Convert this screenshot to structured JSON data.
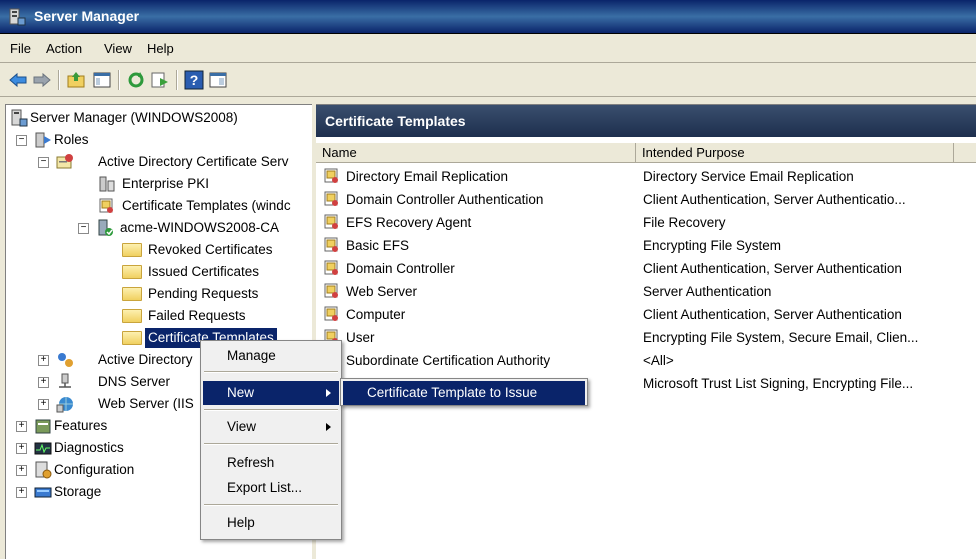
{
  "window": {
    "title": "Server Manager",
    "icon": "server-manager-icon"
  },
  "menubar": {
    "file": "File",
    "action": "Action",
    "view": "View",
    "help": "Help"
  },
  "toolbar": {
    "icons": [
      "back-arrow-icon",
      "forward-arrow-icon",
      "up-folder-icon",
      "show-hide-tree-icon",
      "refresh-icon",
      "export-list-icon",
      "help-icon",
      "properties-icon"
    ]
  },
  "tree": {
    "root": "Server Manager (WINDOWS2008)",
    "roles": "Roles",
    "adcs": "Active Directory Certificate Serv",
    "enterprise_pki": "Enterprise PKI",
    "cert_templates_domain": "Certificate Templates (windc",
    "ca": "acme-WINDOWS2008-CA",
    "revoked": "Revoked Certificates",
    "issued": "Issued Certificates",
    "pending": "Pending Requests",
    "failed": "Failed Requests",
    "ca_templates": "Certificate Templates",
    "ad_other": "Active Directory",
    "dns": "DNS Server",
    "web": "Web Server (IIS",
    "features": "Features",
    "diagnostics": "Diagnostics",
    "configuration": "Configuration",
    "storage": "Storage"
  },
  "main": {
    "header": "Certificate Templates",
    "columns": {
      "name": "Name",
      "purpose": "Intended Purpose"
    },
    "rows": [
      {
        "name": "Directory Email Replication",
        "purpose": "Directory Service Email Replication"
      },
      {
        "name": "Domain Controller Authentication",
        "purpose": "Client Authentication, Server Authenticatio..."
      },
      {
        "name": "EFS Recovery Agent",
        "purpose": "File Recovery"
      },
      {
        "name": "Basic EFS",
        "purpose": "Encrypting File System"
      },
      {
        "name": "Domain Controller",
        "purpose": "Client Authentication, Server Authentication"
      },
      {
        "name": "Web Server",
        "purpose": "Server Authentication"
      },
      {
        "name": "Computer",
        "purpose": "Client Authentication, Server Authentication"
      },
      {
        "name": "User",
        "purpose": "Encrypting File System, Secure Email, Clien..."
      },
      {
        "name": "Subordinate Certification Authority",
        "purpose": "<All>"
      },
      {
        "name": "",
        "purpose": "Microsoft Trust List Signing, Encrypting File..."
      }
    ]
  },
  "context_menu": {
    "manage": "Manage",
    "new": "New",
    "view": "View",
    "refresh": "Refresh",
    "export": "Export List...",
    "help": "Help"
  },
  "submenu": {
    "item": "Certificate Template to Issue"
  },
  "colors": {
    "selection": "#0a246a",
    "header_dark": "#1d2f4e",
    "folder": "#f0d060"
  }
}
